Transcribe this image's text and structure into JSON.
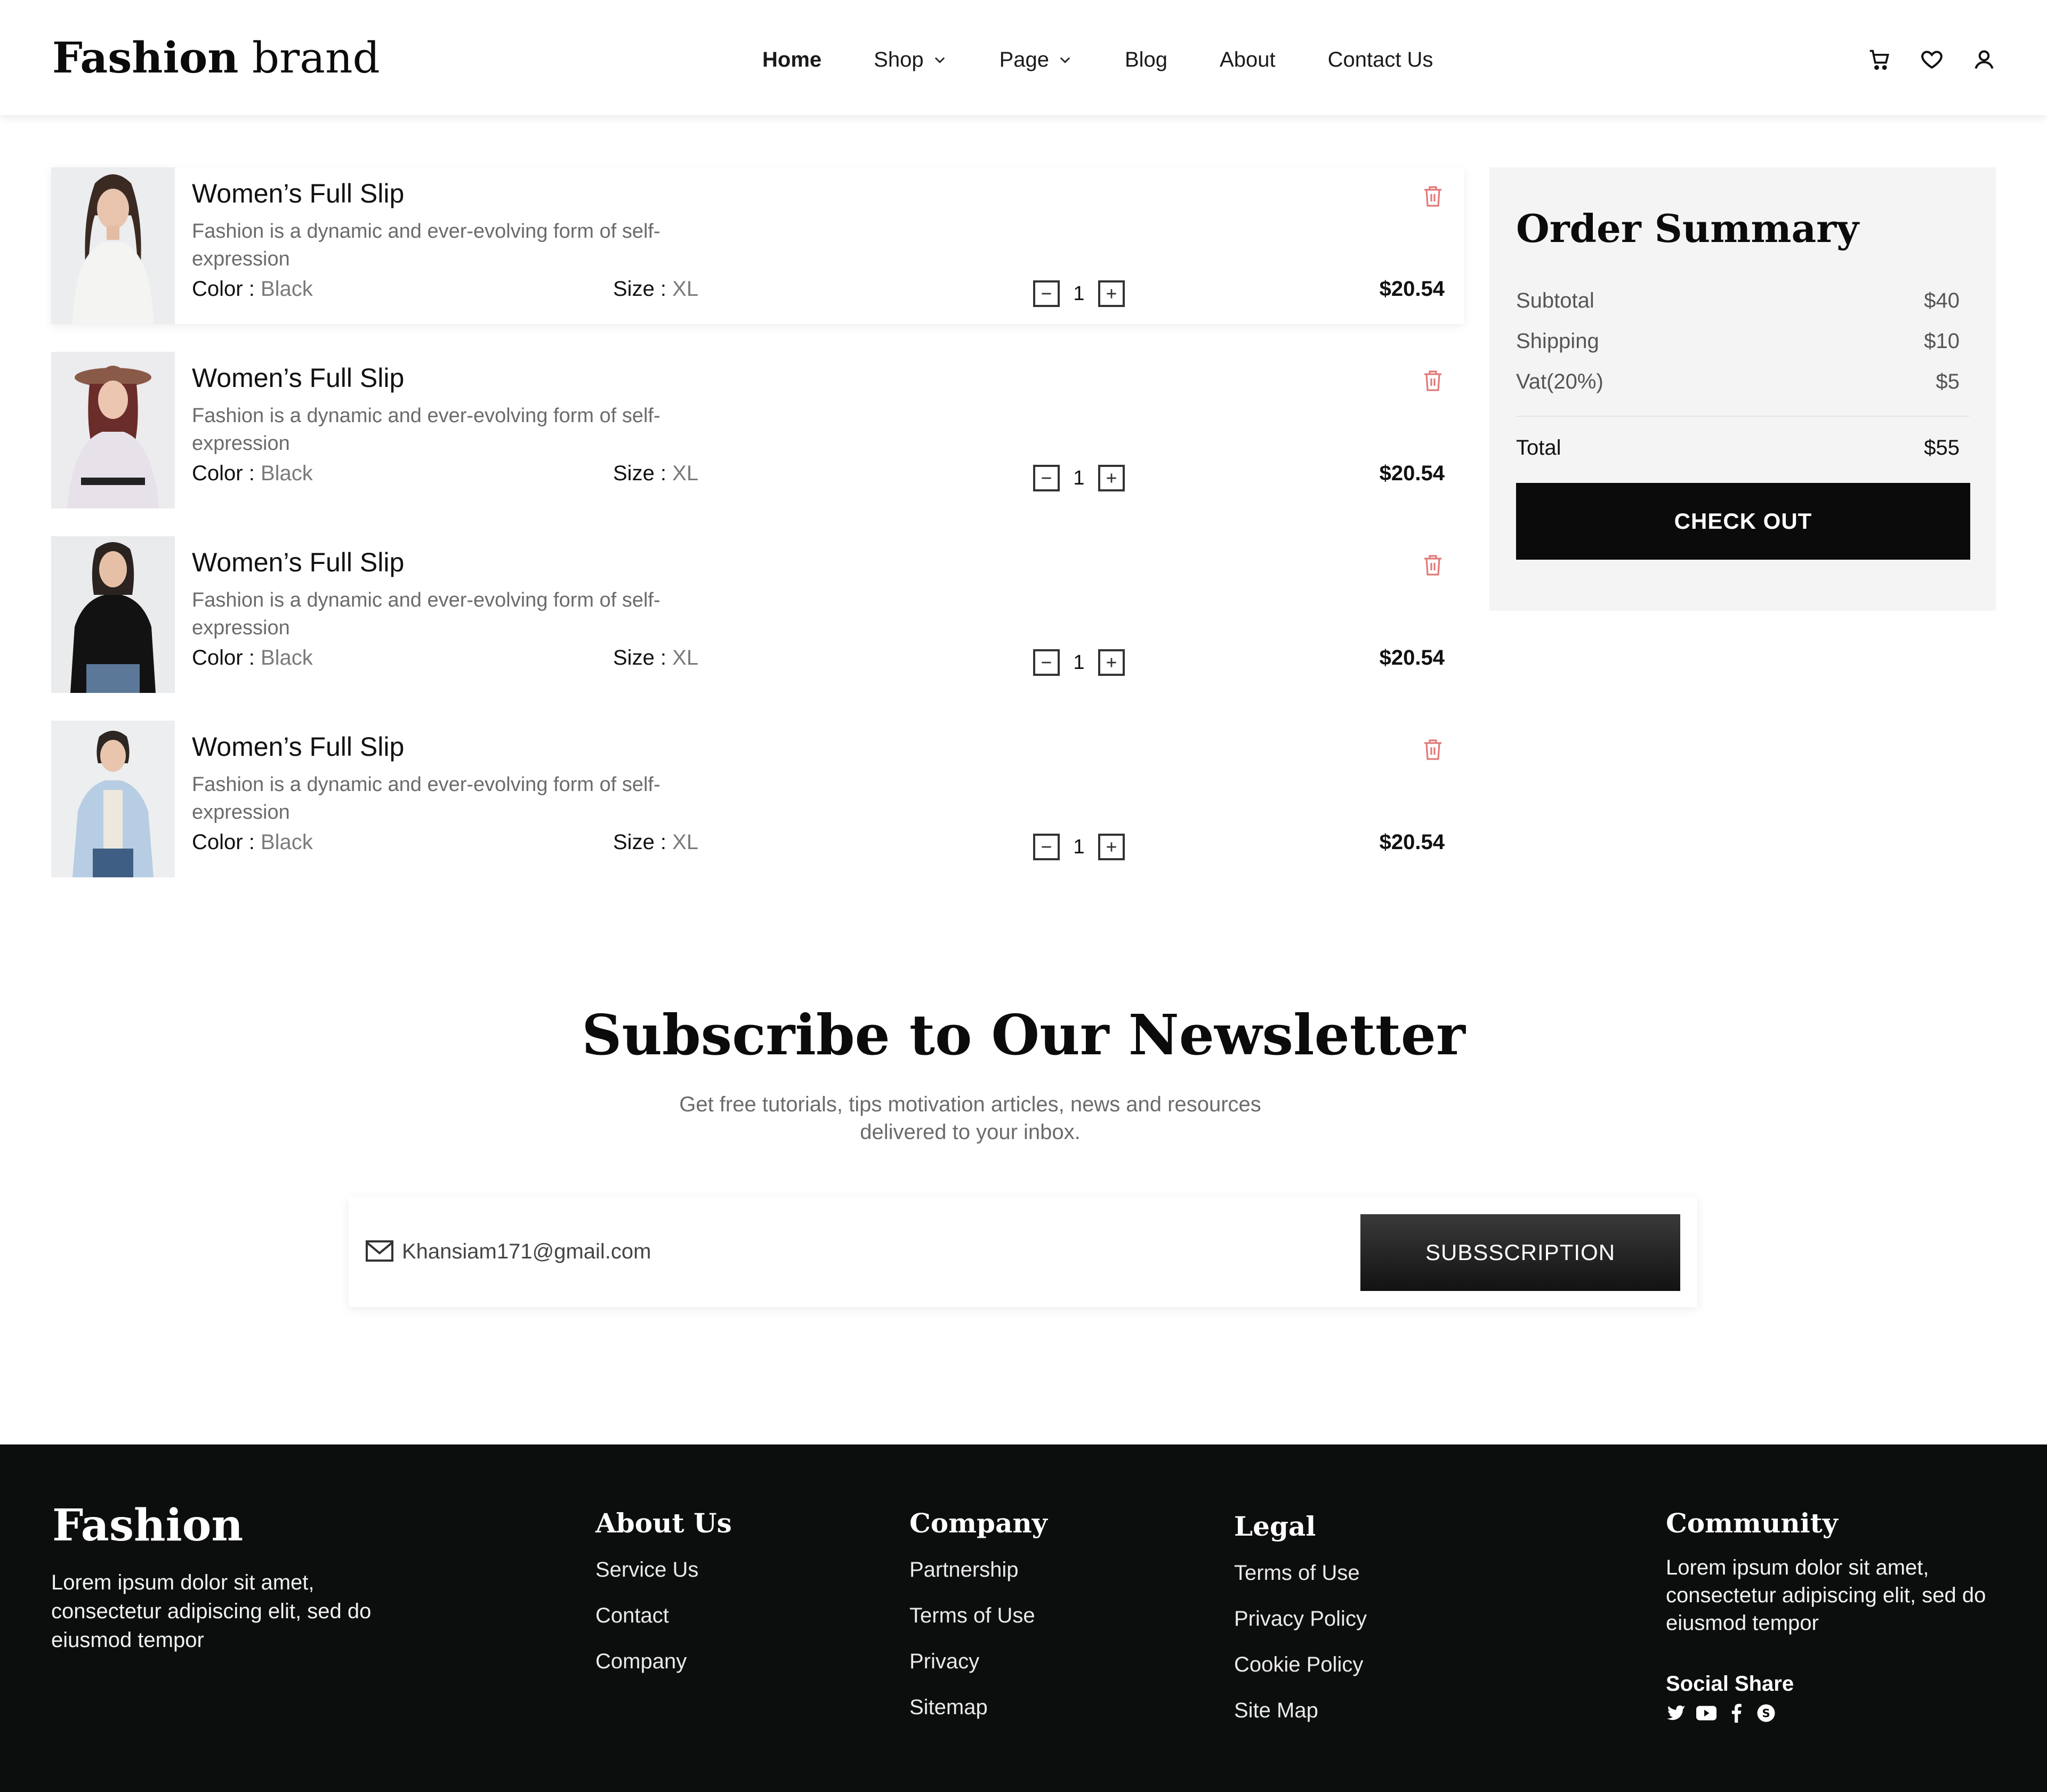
{
  "header": {
    "logo_bold": "Fashion",
    "logo_light": "brand",
    "nav": [
      {
        "label": "Home",
        "active": true
      },
      {
        "label": "Shop",
        "dropdown": true
      },
      {
        "label": "Page",
        "dropdown": true
      },
      {
        "label": "Blog"
      },
      {
        "label": "About"
      },
      {
        "label": "Contact Us"
      }
    ],
    "icons": [
      "cart-icon",
      "heart-icon",
      "user-icon"
    ]
  },
  "cart": {
    "items": [
      {
        "title": "Women’s Full Slip",
        "description": "Fashion is a dynamic and ever-evolving form of self-expression",
        "color_label": "Color :",
        "color": "Black",
        "size_label": "Size :",
        "size": "XL",
        "quantity": "1",
        "price": "$20.54"
      },
      {
        "title": "Women’s Full Slip",
        "description": "Fashion is a dynamic and ever-evolving form of self-expression",
        "color_label": "Color :",
        "color": "Black",
        "size_label": "Size :",
        "size": "XL",
        "quantity": "1",
        "price": "$20.54"
      },
      {
        "title": "Women’s Full Slip",
        "description": "Fashion is a dynamic and ever-evolving form of self-expression",
        "color_label": "Color :",
        "color": "Black",
        "size_label": "Size :",
        "size": "XL",
        "quantity": "1",
        "price": "$20.54"
      },
      {
        "title": "Women’s Full Slip",
        "description": "Fashion is a dynamic and ever-evolving form of self-expression",
        "color_label": "Color :",
        "color": "Black",
        "size_label": "Size :",
        "size": "XL",
        "quantity": "1",
        "price": "$20.54"
      }
    ]
  },
  "summary": {
    "title": "Order Summary",
    "rows": [
      {
        "label": "Subtotal",
        "value": "$40"
      },
      {
        "label": "Shipping",
        "value": "$10"
      },
      {
        "label": "Vat(20%)",
        "value": "$5"
      }
    ],
    "total_label": "Total",
    "total_value": "$55",
    "checkout_label": "CHECK OUT"
  },
  "newsletter": {
    "title": "Subscribe to Our Newsletter",
    "subtitle": "Get free tutorials, tips motivation articles, news and resources delivered to your inbox.",
    "email_value": "Khansiam171@gmail.com",
    "button_label": "SUBSSCRIPTION"
  },
  "footer": {
    "logo": "Fashion",
    "about_text": "Lorem ipsum dolor sit amet, consectetur adipiscing elit, sed do eiusmod tempor",
    "about_us": {
      "title": "About Us",
      "links": [
        "Service Us",
        "Contact",
        "Company"
      ]
    },
    "company": {
      "title": "Company",
      "links": [
        "Partnership",
        "Terms of Use",
        "Privacy",
        "Sitemap"
      ]
    },
    "legal": {
      "title": "Legal",
      "links": [
        "Terms of Use",
        "Privacy Policy",
        "Cookie Policy",
        "Site Map"
      ]
    },
    "community": {
      "title": "Community",
      "text": "Lorem ipsum dolor sit amet, consectetur adipiscing elit, sed do eiusmod tempor",
      "social_title": "Social Share",
      "social_icons": [
        "twitter-icon",
        "youtube-icon",
        "facebook-icon",
        "skype-icon"
      ]
    }
  },
  "colors": {
    "accent": "#0b0b0b",
    "trash": "#e07a7a",
    "footer_bg": "#0c0d0d",
    "summary_bg": "#f4f4f4"
  }
}
